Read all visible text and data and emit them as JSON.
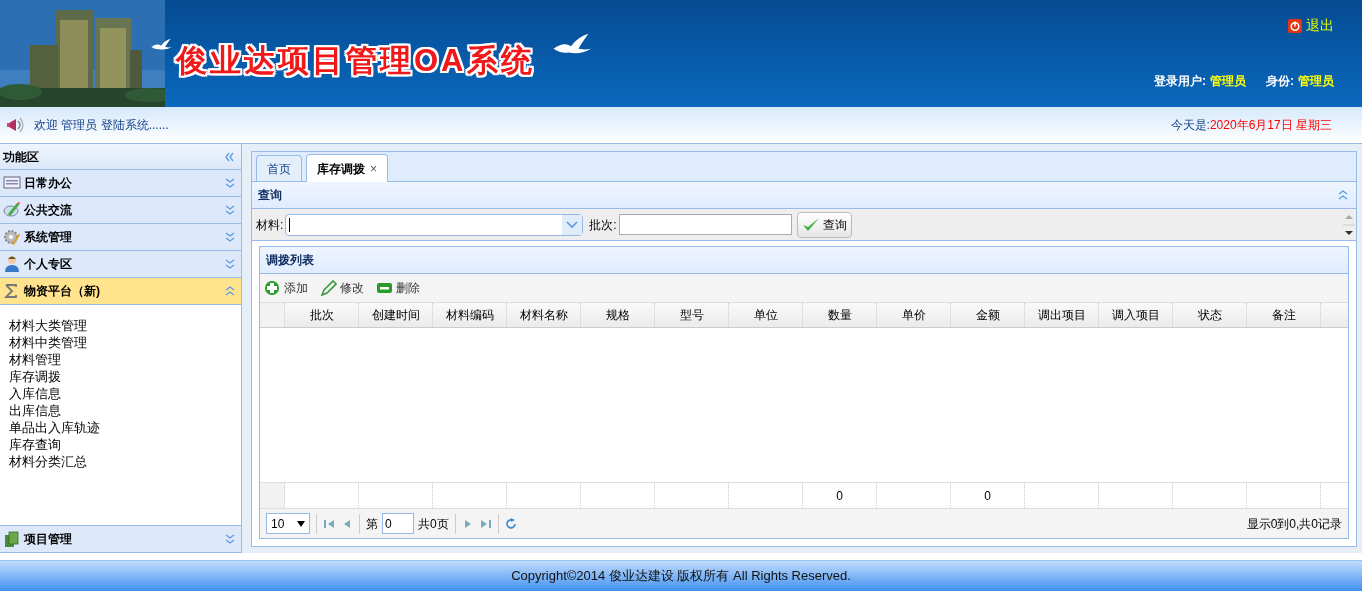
{
  "header": {
    "title": "俊业达项目管理OA系统",
    "logout": "退出",
    "user_label": "登录用户:",
    "user_value": "管理员",
    "role_label": "身份:",
    "role_value": "管理员"
  },
  "welcome": {
    "text": "欢迎 管理员 登陆系统......",
    "date_label": "今天是:",
    "date": "2020年6月17日 星期三"
  },
  "sidebar": {
    "title": "功能区",
    "sections": [
      {
        "label": "日常办公",
        "expanded": false
      },
      {
        "label": "公共交流",
        "expanded": false
      },
      {
        "label": "系统管理",
        "expanded": false
      },
      {
        "label": "个人专区",
        "expanded": false
      },
      {
        "label": "物资平台（新)",
        "expanded": true,
        "items": [
          "材料大类管理",
          "材料中类管理",
          "材料管理",
          "库存调拨",
          "入库信息",
          "出库信息",
          "单品出入库轨迹",
          "库存查询",
          "材料分类汇总"
        ]
      },
      {
        "label": "项目管理",
        "expanded": false
      }
    ]
  },
  "tabs": [
    {
      "label": "首页",
      "selected": false,
      "closable": false
    },
    {
      "label": "库存调拨",
      "selected": true,
      "closable": true,
      "close": "×"
    }
  ],
  "query": {
    "title": "查询",
    "material_label": "材料:",
    "batch_label": "批次:",
    "button": "查询"
  },
  "grid": {
    "title": "调拨列表",
    "toolbar": [
      {
        "kind": "add",
        "label": "添加"
      },
      {
        "kind": "edit",
        "label": "修改"
      },
      {
        "kind": "delete",
        "label": "删除"
      }
    ],
    "columns": [
      {
        "label": "批次"
      },
      {
        "label": "创建时间"
      },
      {
        "label": "材料编码"
      },
      {
        "label": "材料名称"
      },
      {
        "label": "规格"
      },
      {
        "label": "型号"
      },
      {
        "label": "单位"
      },
      {
        "label": "数量",
        "footer": "0"
      },
      {
        "label": "单价"
      },
      {
        "label": "金额",
        "footer": "0"
      },
      {
        "label": "调出项目"
      },
      {
        "label": "调入项目"
      },
      {
        "label": "状态"
      },
      {
        "label": "备注"
      }
    ],
    "pager": {
      "page_size": "10",
      "page_label": "第",
      "page": "0",
      "total": "共0页",
      "summary": "显示0到0,共0记录"
    }
  },
  "footer": "Copyright©2014 俊业达建设 版权所有 All Rights Reserved."
}
